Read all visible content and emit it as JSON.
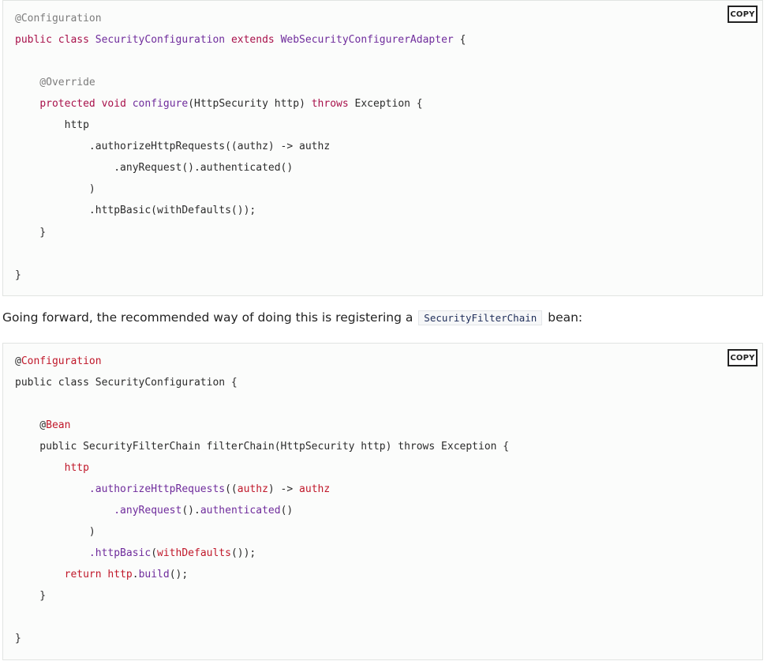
{
  "copy_label": "COPY",
  "block1": {
    "lines": [
      [
        {
          "t": "@Configuration",
          "c": "ann"
        }
      ],
      [
        {
          "t": "public",
          "c": "kw"
        },
        {
          "t": " ",
          "c": "plain"
        },
        {
          "t": "class",
          "c": "kw"
        },
        {
          "t": " SecurityConfiguration ",
          "c": "cls"
        },
        {
          "t": "extends",
          "c": "kw"
        },
        {
          "t": " WebSecurityConfigurerAdapter ",
          "c": "cls"
        },
        {
          "t": "{",
          "c": "plain"
        }
      ],
      [],
      [
        {
          "t": "    @Override",
          "c": "ann"
        }
      ],
      [
        {
          "t": "    ",
          "c": "plain"
        },
        {
          "t": "protected",
          "c": "kw"
        },
        {
          "t": " ",
          "c": "plain"
        },
        {
          "t": "void",
          "c": "kw"
        },
        {
          "t": " configure",
          "c": "cls"
        },
        {
          "t": "(HttpSecurity http) ",
          "c": "plain"
        },
        {
          "t": "throws",
          "c": "kw"
        },
        {
          "t": " Exception {",
          "c": "plain"
        }
      ],
      [
        {
          "t": "        http",
          "c": "plain"
        }
      ],
      [
        {
          "t": "            .authorizeHttpRequests((authz) -> authz",
          "c": "plain"
        }
      ],
      [
        {
          "t": "                .anyRequest().authenticated()",
          "c": "plain"
        }
      ],
      [
        {
          "t": "            )",
          "c": "plain"
        }
      ],
      [
        {
          "t": "            .httpBasic(withDefaults());",
          "c": "plain"
        }
      ],
      [
        {
          "t": "    }",
          "c": "plain"
        }
      ],
      [],
      [
        {
          "t": "}",
          "c": "plain"
        }
      ]
    ]
  },
  "prose": {
    "before": "Going forward, the recommended way of doing this is registering a",
    "code": "SecurityFilterChain",
    "after": "bean:"
  },
  "block2": {
    "lines": [
      [
        {
          "t": "@",
          "c": "plain"
        },
        {
          "t": "Configuration",
          "c": "red"
        }
      ],
      [
        {
          "t": "public class SecurityConfiguration {",
          "c": "plain"
        }
      ],
      [],
      [
        {
          "t": "    @",
          "c": "plain"
        },
        {
          "t": "Bean",
          "c": "red"
        }
      ],
      [
        {
          "t": "    public SecurityFilterChain filterChain(HttpSecurity http) throws Exception {",
          "c": "plain"
        }
      ],
      [
        {
          "t": "        ",
          "c": "plain"
        },
        {
          "t": "http",
          "c": "red"
        }
      ],
      [
        {
          "t": "            ",
          "c": "plain"
        },
        {
          "t": ".authorizeHttpRequests",
          "c": "cls"
        },
        {
          "t": "((",
          "c": "plain"
        },
        {
          "t": "authz",
          "c": "red"
        },
        {
          "t": ") -> ",
          "c": "plain"
        },
        {
          "t": "authz",
          "c": "red"
        }
      ],
      [
        {
          "t": "                ",
          "c": "plain"
        },
        {
          "t": ".anyRequest",
          "c": "cls"
        },
        {
          "t": "().",
          "c": "plain"
        },
        {
          "t": "authenticated",
          "c": "cls"
        },
        {
          "t": "()",
          "c": "plain"
        }
      ],
      [
        {
          "t": "            )",
          "c": "plain"
        }
      ],
      [
        {
          "t": "            ",
          "c": "plain"
        },
        {
          "t": ".httpBasic",
          "c": "cls"
        },
        {
          "t": "(",
          "c": "plain"
        },
        {
          "t": "withDefaults",
          "c": "red"
        },
        {
          "t": "());",
          "c": "plain"
        }
      ],
      [
        {
          "t": "        ",
          "c": "plain"
        },
        {
          "t": "return",
          "c": "red"
        },
        {
          "t": " ",
          "c": "plain"
        },
        {
          "t": "http",
          "c": "red"
        },
        {
          "t": ".",
          "c": "plain"
        },
        {
          "t": "build",
          "c": "cls"
        },
        {
          "t": "();",
          "c": "plain"
        }
      ],
      [
        {
          "t": "    }",
          "c": "plain"
        }
      ],
      [],
      [
        {
          "t": "}",
          "c": "plain"
        }
      ]
    ]
  }
}
